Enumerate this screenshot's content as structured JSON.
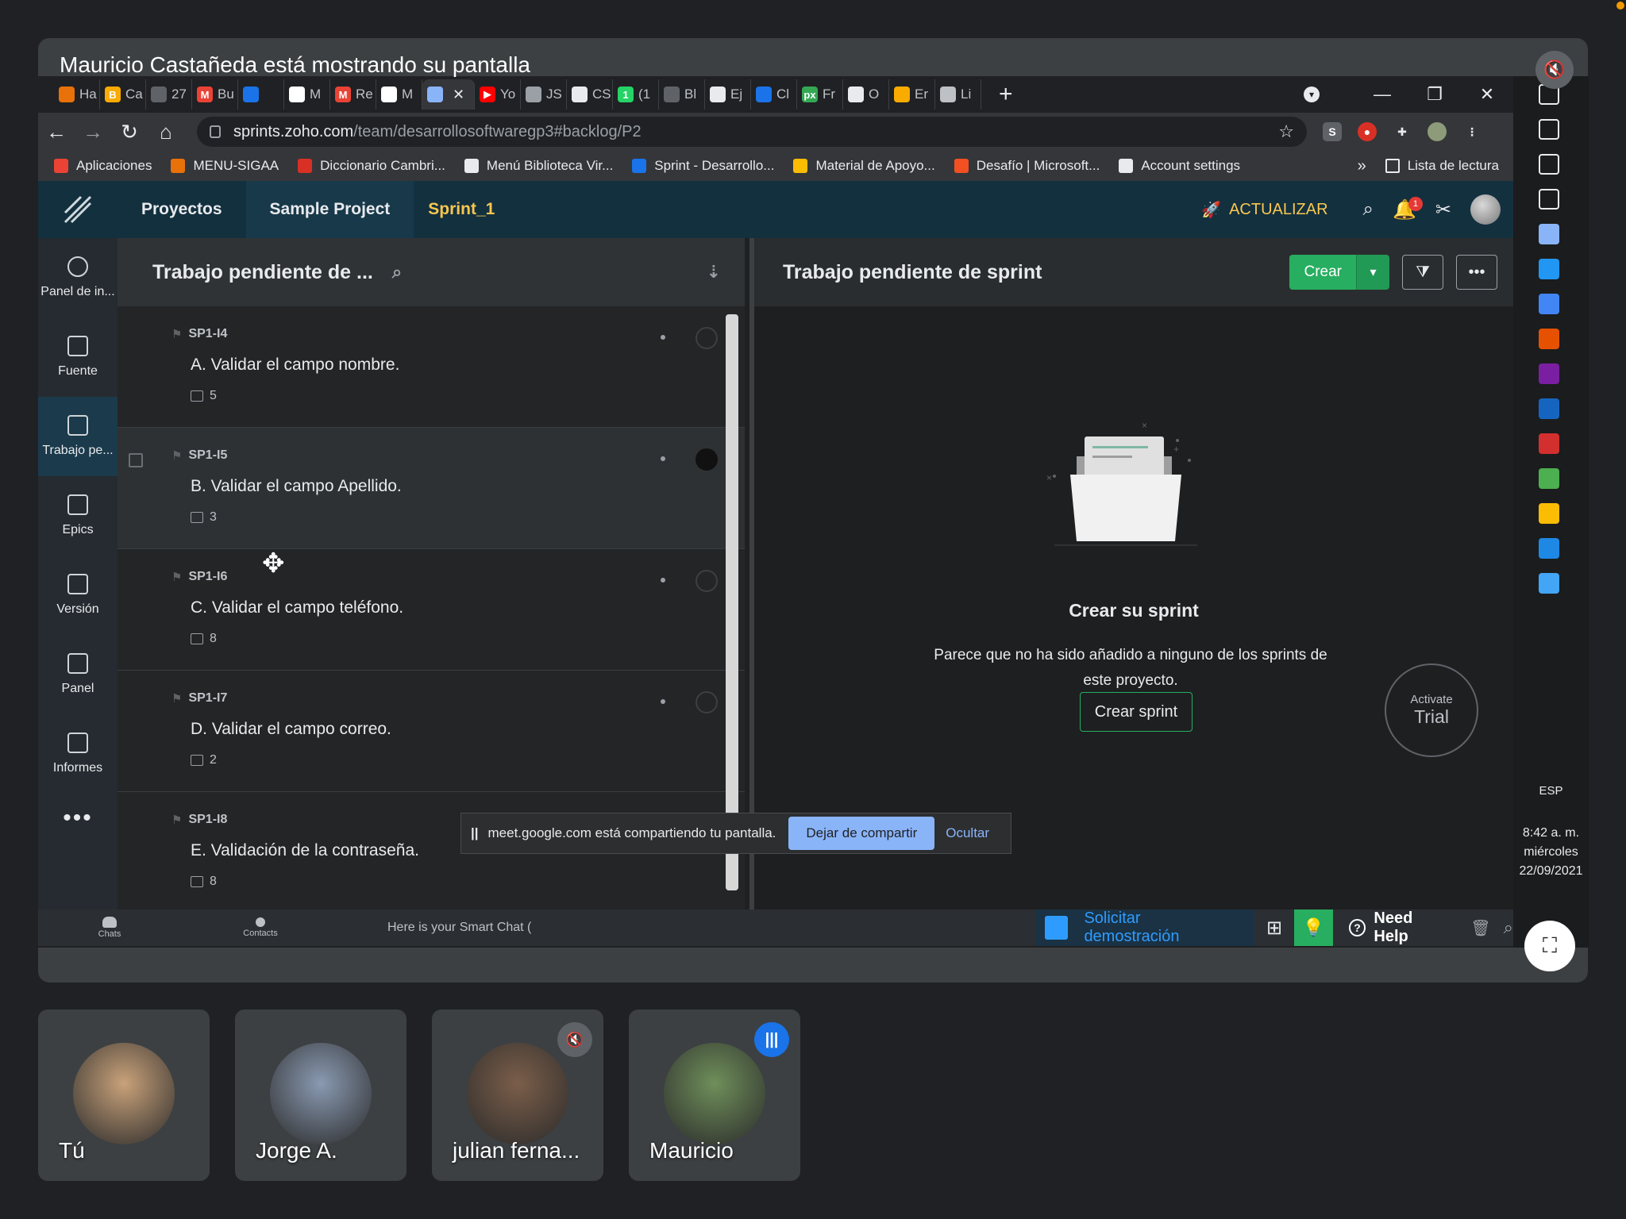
{
  "meet": {
    "presenter_caption": "Mauricio Castañeda está mostrando su pantalla",
    "participants": [
      {
        "name": "Tú",
        "color": "#c9a27a"
      },
      {
        "name": "Jorge A.",
        "color": "#8a9ab2"
      },
      {
        "name": "julian ferna...",
        "color": "#7b5e4a"
      },
      {
        "name": "Mauricio",
        "color": "#6f8f5a"
      }
    ]
  },
  "browser": {
    "tabs": [
      {
        "label": "Ha",
        "color": "#e8710a",
        "glyph": ""
      },
      {
        "label": "Ca",
        "color": "#f9ab00",
        "glyph": "B"
      },
      {
        "label": "27",
        "color": "#5f6368",
        "glyph": ""
      },
      {
        "label": "Bu",
        "color": "#ea4335",
        "glyph": "M"
      },
      {
        "label": "",
        "color": "#1a73e8",
        "glyph": ""
      },
      {
        "label": "M",
        "color": "#ffffff",
        "glyph": ""
      },
      {
        "label": "Re",
        "color": "#ea4335",
        "glyph": "M"
      },
      {
        "label": "M",
        "color": "#ffffff",
        "glyph": ""
      },
      {
        "label": "",
        "color": "#8ab4f8",
        "glyph": "",
        "active": true
      },
      {
        "label": "Yo",
        "color": "#ff0000",
        "glyph": "▶"
      },
      {
        "label": "JS",
        "color": "#9aa0a6",
        "glyph": ""
      },
      {
        "label": "CS",
        "color": "#e8eaed",
        "glyph": ""
      },
      {
        "label": "(1",
        "color": "#25d366",
        "glyph": "1"
      },
      {
        "label": "Bl",
        "color": "#5f6368",
        "glyph": ""
      },
      {
        "label": "Ej",
        "color": "#e8eaed",
        "glyph": ""
      },
      {
        "label": "Cl",
        "color": "#1a73e8",
        "glyph": ""
      },
      {
        "label": "Fr",
        "color": "#34a853",
        "glyph": "px"
      },
      {
        "label": "O",
        "color": "#e8eaed",
        "glyph": ""
      },
      {
        "label": "Er",
        "color": "#f9ab00",
        "glyph": ""
      },
      {
        "label": "Li",
        "color": "#bdc1c6",
        "glyph": ""
      }
    ],
    "close_tab_glyph": "✕",
    "new_tab_glyph": "+",
    "window_controls": [
      "—",
      "❐",
      "✕"
    ],
    "url_host": "sprints.zoho.com",
    "url_path": "/team/desarrollosoftwaregp3#backlog/P2",
    "bookmarks": [
      {
        "label": "Aplicaciones",
        "color": "#ea4335"
      },
      {
        "label": "MENU-SIGAA",
        "color": "#e8710a"
      },
      {
        "label": "Diccionario Cambri...",
        "color": "#d93025"
      },
      {
        "label": "Menú Biblioteca Vir...",
        "color": "#e8eaed"
      },
      {
        "label": "Sprint - Desarrollo...",
        "color": "#1a73e8"
      },
      {
        "label": "Material de Apoyo...",
        "color": "#fbbc04"
      },
      {
        "label": "Desafío | Microsoft...",
        "color": "#f25022"
      },
      {
        "label": "Account settings",
        "color": "#e8eaed"
      }
    ],
    "bookmarks_more": "»",
    "reading_list": "Lista de lectura"
  },
  "zoho": {
    "nav": [
      "Proyectos",
      "Sample Project",
      "Sprint_1"
    ],
    "update_label": "ACTUALIZAR",
    "notification_count": "1",
    "leftnav": [
      {
        "label": "Panel de in...",
        "icon": "dashboard-icon"
      },
      {
        "label": "Fuente",
        "icon": "feed-icon"
      },
      {
        "label": "Trabajo pe...",
        "icon": "backlog-icon",
        "active": true
      },
      {
        "label": "Epics",
        "icon": "epics-icon"
      },
      {
        "label": "Versión",
        "icon": "release-icon"
      },
      {
        "label": "Panel",
        "icon": "board-icon"
      },
      {
        "label": "Informes",
        "icon": "reports-icon"
      }
    ],
    "leftnav_more": "•••",
    "backlog_title": "Trabajo pendiente de ...",
    "stories": [
      {
        "id": "SP1-I4",
        "title": "A. Validar el campo nombre.",
        "points": "5"
      },
      {
        "id": "SP1-I5",
        "title": "B. Validar el campo Apellido.",
        "points": "3"
      },
      {
        "id": "SP1-I6",
        "title": "C. Validar el campo teléfono.",
        "points": "8"
      },
      {
        "id": "SP1-I7",
        "title": "D. Validar el campo correo.",
        "points": "2"
      },
      {
        "id": "SP1-I8",
        "title": "E. Validación de la contraseña.",
        "points": "8"
      }
    ],
    "sprint_title": "Trabajo pendiente de sprint",
    "create_label": "Crear",
    "empty_title": "Crear su sprint",
    "empty_text": "Parece que no ha sido añadido a ninguno de los sprints de este proyecto.",
    "create_sprint_label": "Crear sprint",
    "trial_line1": "Activate",
    "trial_line2": "Trial",
    "chat_labels": [
      "Chats",
      "Contacts"
    ],
    "smart_chat": "Here is your Smart Chat (",
    "demo_label": "Solicitar demostración",
    "need_help": "Need Help"
  },
  "share_notice": {
    "text": "meet.google.com está compartiendo tu pantalla.",
    "stop_label": "Dejar de compartir",
    "hide_label": "Ocultar"
  },
  "taskbar": {
    "lang": "ESP",
    "time": "8:42 a. m.",
    "day": "miércoles",
    "date": "22/09/2021"
  }
}
